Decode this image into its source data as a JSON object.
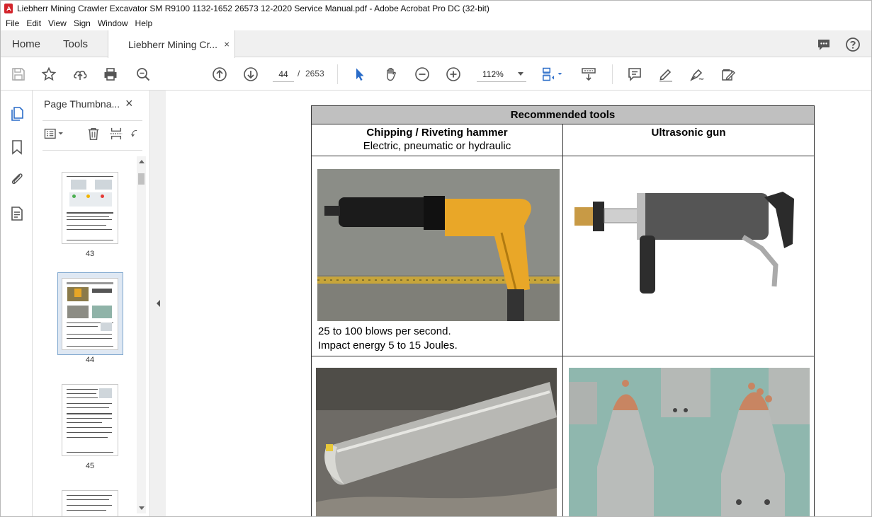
{
  "window": {
    "title": "Liebherr Mining Crawler Excavator SM R9100 1132-1652 26573 12-2020 Service Manual.pdf - Adobe Acrobat Pro DC (32-bit)"
  },
  "menu": [
    "File",
    "Edit",
    "View",
    "Sign",
    "Window",
    "Help"
  ],
  "tabs": {
    "home": "Home",
    "tools": "Tools",
    "document": "Liebherr Mining Cr...",
    "close": "×"
  },
  "toolbar": {
    "page_current": "44",
    "page_sep": "/",
    "page_total": "2653",
    "zoom": "112%"
  },
  "panel": {
    "title": "Page Thumbna...",
    "close": "×",
    "thumbnails": [
      {
        "label": "43"
      },
      {
        "label": "44",
        "selected": true
      },
      {
        "label": "45"
      }
    ]
  },
  "document": {
    "table_title": "Recommended tools",
    "col1_title": "Chipping / Riveting hammer",
    "col1_subtitle": "Electric, pneumatic or hydraulic",
    "col2_title": "Ultrasonic gun",
    "spec_line1": "25 to 100 blows per second.",
    "spec_line2": "Impact energy 5 to 15 Joules."
  },
  "colors": {
    "accent": "#2a6cc8",
    "brand_red": "#d3242b",
    "table_header_bg": "#c0c0c0"
  }
}
